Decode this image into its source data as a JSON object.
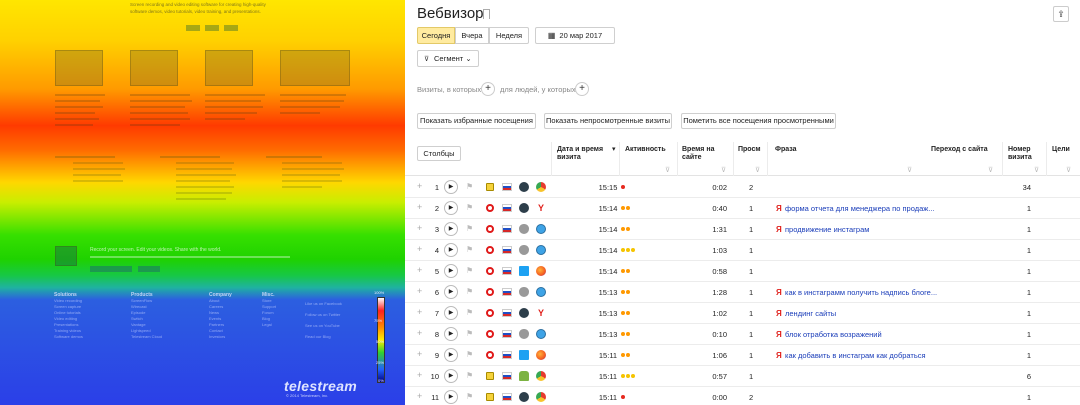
{
  "heatmap": {
    "top_text_line1": "Screen recording and video editing software for creating high-quality",
    "top_text_line2": "software demos, video tutorials, video training, and presentations.",
    "banner": "Record your screen.  Edit your videos.  Share with the world.",
    "footer_columns": [
      {
        "title": "Solutions",
        "items": [
          "Video recording",
          "Screen capture",
          "Online tutorials",
          "Video editing",
          "Presentations",
          "Training videos",
          "Software demos"
        ]
      },
      {
        "title": "Products",
        "items": [
          "ScreenFlow",
          "Wirecast",
          "Episode",
          "Switch",
          "Vantage",
          "Lightspeed",
          "Telestream Cloud"
        ]
      },
      {
        "title": "Company",
        "items": [
          "About",
          "Careers",
          "News",
          "Events",
          "Partners",
          "Contact",
          "Investors"
        ]
      },
      {
        "title": "Misc.",
        "items": [
          "Store",
          "Support",
          "Forum",
          "Blog",
          "Legal"
        ]
      }
    ],
    "social": [
      "Like us on Facebook",
      "Follow us on Twitter",
      "See us on YouTube",
      "Read our Blog"
    ],
    "scale_labels": [
      "100%",
      "75%",
      "50%",
      "25%",
      "0%"
    ],
    "brand": "telestream",
    "copyright": "© 2014 Telestream, Inc."
  },
  "webvisor": {
    "title": "Вебвизор",
    "tabs": [
      "Сегодня",
      "Вчера",
      "Неделя"
    ],
    "active_tab": "Сегодня",
    "date": "20 мар 2017",
    "segment": "Сегмент",
    "visit_filter_label": "Визиты, в которых",
    "people_filter_label": "для людей, у которых",
    "actions": [
      "Показать избранные посещения",
      "Показать непросмотренные визиты",
      "Пометить все посещения просмотренными"
    ],
    "columns_button": "Столбцы",
    "headers": {
      "datetime": "Дата и время визита",
      "activity": "Активность",
      "time": "Время на сайте",
      "views": "Просм",
      "phrase": "Фраза",
      "referer": "Переход с сайта",
      "visit_number": "Номер визита",
      "goals": "Цели"
    },
    "rows": [
      {
        "n": "1",
        "source": "direct",
        "os": "linux",
        "browser": "chrome",
        "time": "15:15",
        "activity": 1,
        "duration": "0:02",
        "views": "2",
        "phrase": "",
        "visit_number": "34"
      },
      {
        "n": "2",
        "source": "search",
        "os": "linux",
        "browser": "yandex",
        "time": "15:14",
        "activity": 2,
        "duration": "0:40",
        "views": "1",
        "phrase": "форма отчета для менеджера по продаж...",
        "visit_number": "1"
      },
      {
        "n": "3",
        "source": "search",
        "os": "apple",
        "browser": "safari",
        "time": "15:14",
        "activity": 2,
        "duration": "1:31",
        "views": "1",
        "phrase": "продвижение инстаграм",
        "visit_number": "1"
      },
      {
        "n": "4",
        "source": "search",
        "os": "apple",
        "browser": "safari",
        "time": "15:14",
        "activity": 3,
        "duration": "1:03",
        "views": "1",
        "phrase": "",
        "visit_number": "1"
      },
      {
        "n": "5",
        "source": "search",
        "os": "windows",
        "browser": "firefox",
        "time": "15:14",
        "activity": 2,
        "duration": "0:58",
        "views": "1",
        "phrase": "",
        "visit_number": "1"
      },
      {
        "n": "6",
        "source": "search",
        "os": "apple",
        "browser": "safari",
        "time": "15:13",
        "activity": 2,
        "duration": "1:28",
        "views": "1",
        "phrase": "как в инстаграмм получить надпись блоге...",
        "visit_number": "1"
      },
      {
        "n": "7",
        "source": "search",
        "os": "linux",
        "browser": "yandex",
        "time": "15:13",
        "activity": 2,
        "duration": "1:02",
        "views": "1",
        "phrase": "лендинг сайты",
        "visit_number": "1"
      },
      {
        "n": "8",
        "source": "search",
        "os": "apple",
        "browser": "safari",
        "time": "15:13",
        "activity": 2,
        "duration": "0:10",
        "views": "1",
        "phrase": "блок отработка возражений",
        "visit_number": "1"
      },
      {
        "n": "9",
        "source": "search",
        "os": "windows",
        "browser": "firefox",
        "time": "15:11",
        "activity": 2,
        "duration": "1:06",
        "views": "1",
        "phrase": "как добавить в инстаграм как добраться",
        "visit_number": "1"
      },
      {
        "n": "10",
        "source": "direct",
        "os": "android",
        "browser": "chrome",
        "time": "15:11",
        "activity": 3,
        "duration": "0:57",
        "views": "1",
        "phrase": "",
        "visit_number": "6"
      },
      {
        "n": "11",
        "source": "direct",
        "os": "linux",
        "browser": "chrome",
        "time": "15:11",
        "activity": 1,
        "duration": "0:00",
        "views": "2",
        "phrase": "",
        "visit_number": "1"
      }
    ],
    "colors": {
      "activity_low": "#e62a1f",
      "activity_mid": "#ff9900",
      "activity_high": "#f5c400",
      "link": "#1a3db9",
      "tab_active": "#ffeba0"
    }
  }
}
